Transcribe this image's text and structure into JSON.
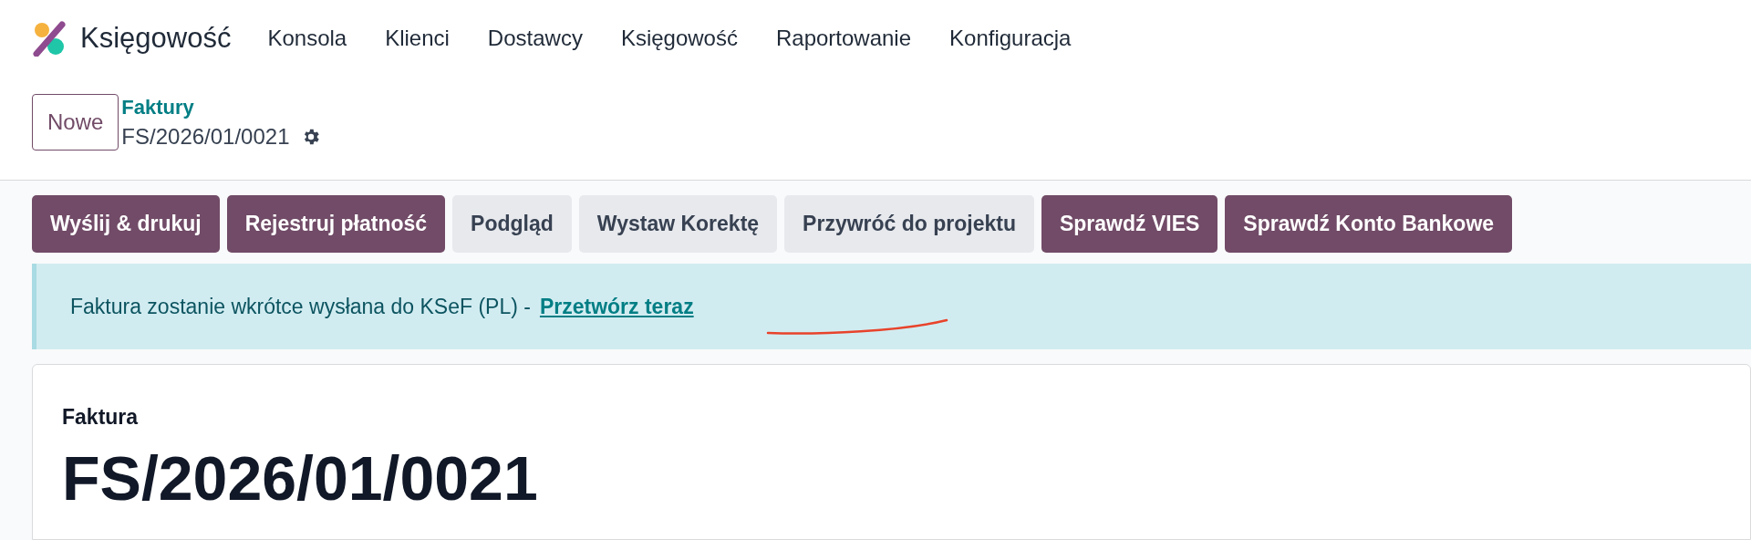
{
  "navbar": {
    "app_name": "Księgowość",
    "menu": [
      "Konsola",
      "Klienci",
      "Dostawcy",
      "Księgowość",
      "Raportowanie",
      "Konfiguracja"
    ]
  },
  "control_panel": {
    "new_button": "Nowe",
    "breadcrumb": "Faktury",
    "record": "FS/2026/01/0021"
  },
  "actions": [
    {
      "label": "Wyślij & drukuj",
      "kind": "primary"
    },
    {
      "label": "Rejestruj płatność",
      "kind": "primary"
    },
    {
      "label": "Podgląd",
      "kind": "secondary"
    },
    {
      "label": "Wystaw Korektę",
      "kind": "secondary"
    },
    {
      "label": "Przywróć do projektu",
      "kind": "secondary"
    },
    {
      "label": "Sprawdź VIES",
      "kind": "primary"
    },
    {
      "label": "Sprawdź Konto Bankowe",
      "kind": "primary"
    }
  ],
  "alert": {
    "text": "Faktura zostanie wkrótce wysłana do KSeF (PL) -",
    "link": "Przetwórz teraz"
  },
  "form": {
    "type_label": "Faktura",
    "name": "FS/2026/01/0021"
  }
}
